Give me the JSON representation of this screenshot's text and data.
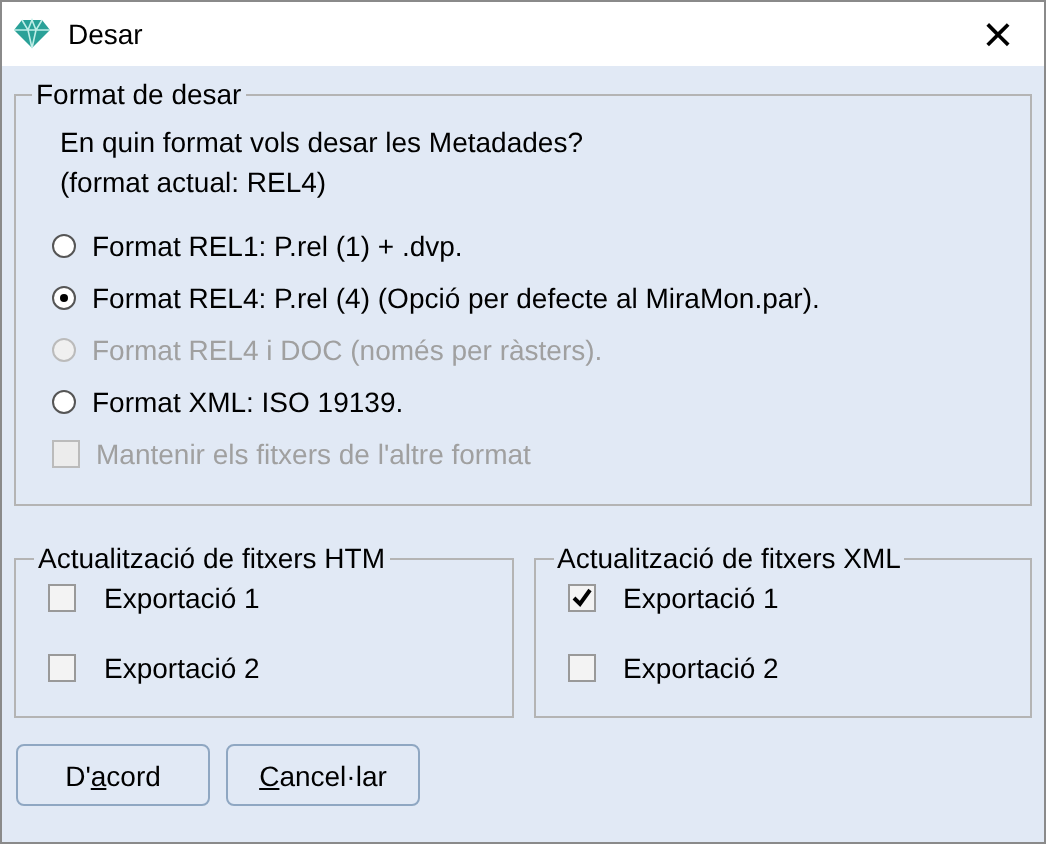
{
  "window": {
    "title": "Desar",
    "close": "×"
  },
  "format_group": {
    "title": "Format de desar",
    "prompt": "En quin format vols desar les Metadades?",
    "current": "(format actual: REL4)",
    "options": [
      {
        "label": "Format REL1: P.rel (1) + .dvp.",
        "selected": false,
        "disabled": false
      },
      {
        "label": "Format REL4: P.rel (4) (Opció per defecte al MiraMon.par).",
        "selected": true,
        "disabled": false
      },
      {
        "label": "Format REL4 i DOC (només per ràsters).",
        "selected": false,
        "disabled": true
      },
      {
        "label": "Format XML: ISO 19139.",
        "selected": false,
        "disabled": false
      }
    ],
    "keep": {
      "label": "Mantenir els fitxers de l'altre format",
      "checked": false,
      "disabled": true
    }
  },
  "update_groups": [
    {
      "title": "Actualització de fitxers HTM",
      "items": [
        {
          "label": "Exportació 1",
          "checked": false
        },
        {
          "label": "Exportació 2",
          "checked": false
        }
      ]
    },
    {
      "title": "Actualització de fitxers XML",
      "items": [
        {
          "label": "Exportació 1",
          "checked": true
        },
        {
          "label": "Exportació 2",
          "checked": false
        }
      ]
    }
  ],
  "buttons": [
    {
      "before": "D'",
      "key": "a",
      "after": "cord"
    },
    {
      "key": "C",
      "after": "ancel·lar"
    }
  ]
}
